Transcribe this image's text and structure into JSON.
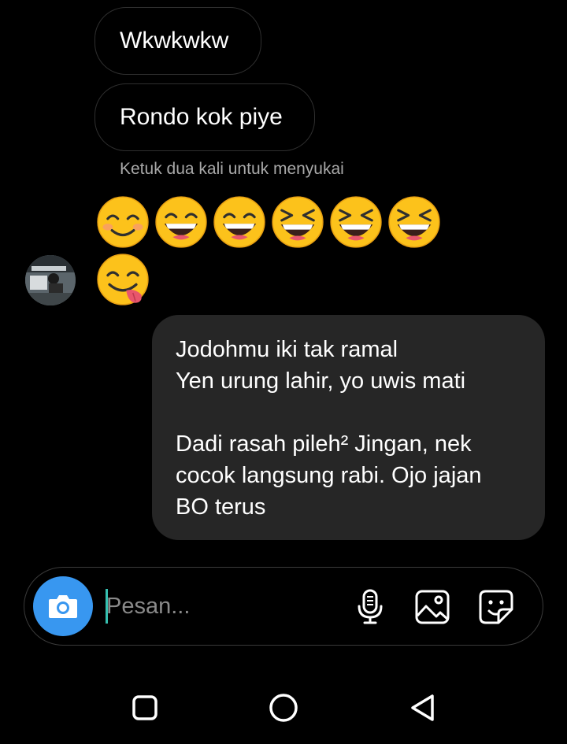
{
  "messages": {
    "incoming": [
      {
        "text": "Wkwkwkw"
      },
      {
        "text": "Rondo kok piye"
      }
    ],
    "double_tap_hint": "Ketuk dua kali untuk menyukai",
    "emoji_row1": [
      "smiling-face-with-smiling-eyes-icon",
      "grinning-face-icon",
      "grinning-face-icon",
      "squinting-face-icon",
      "squinting-face-icon",
      "squinting-face-icon"
    ],
    "emoji_row2": [
      "face-savoring-food-icon"
    ],
    "outgoing": {
      "lines": [
        "Jodohmu iki tak ramal",
        "Yen urung lahir, yo uwis mati",
        "",
        "Dadi rasah pileh² Jingan, nek",
        "cocok langsung rabi. Ojo jajan",
        "BO terus"
      ]
    }
  },
  "composer": {
    "placeholder": "Pesan...",
    "value": ""
  },
  "colors": {
    "background": "#000000",
    "outgoing_bubble": "#262626",
    "incoming_border": "#2f2f2f",
    "camera_button": "#3897f0",
    "hint_text": "#a8a8a8"
  }
}
